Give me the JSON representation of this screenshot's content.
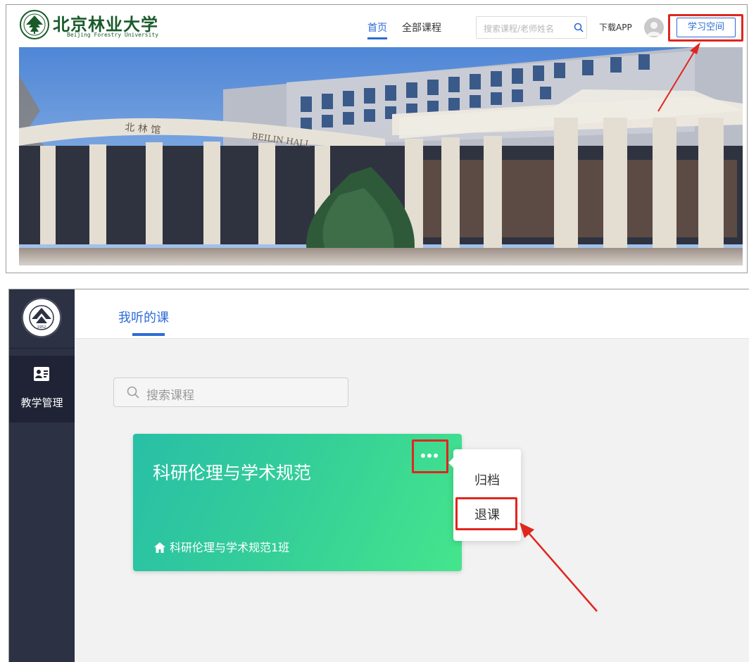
{
  "site": {
    "logo_cn": "北京林业大学",
    "logo_en": "Beijing Forestry University",
    "nav": [
      {
        "label": "首页"
      },
      {
        "label": "全部课程"
      }
    ],
    "search_placeholder": "搜索课程/老师姓名",
    "download_app": "下载APP",
    "study_space_button": "学习空间",
    "banner_sign": "BEILIN HALL",
    "banner_sign_cn": "北 林 馆"
  },
  "dashboard": {
    "side_nav": {
      "emblem_year": "1952",
      "items": [
        {
          "label": "教学管理",
          "icon": "teaching-icon"
        }
      ]
    },
    "tabs": [
      {
        "label": "我听的课"
      }
    ],
    "search_placeholder": "搜索课程",
    "course": {
      "title": "科研伦理与学术规范",
      "class_name": "科研伦理与学术规范1班"
    },
    "course_menu": [
      {
        "label": "归档"
      },
      {
        "label": "退课"
      }
    ]
  },
  "colors": {
    "accent": "#2d6bd8",
    "highlight": "#e0261f",
    "sidebar": "#2c3144",
    "card_gradient_start": "#28bfa6",
    "card_gradient_end": "#45e58c",
    "brand_green": "#1a5a2a"
  }
}
